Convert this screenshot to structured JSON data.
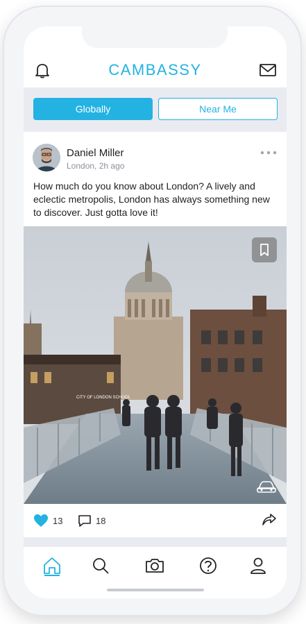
{
  "app": {
    "brand": "CAMBASSY"
  },
  "tabs": [
    {
      "label": "Globally",
      "active": true
    },
    {
      "label": "Near Me",
      "active": false
    }
  ],
  "post": {
    "author": "Daniel Miller",
    "meta": "London, 2h ago",
    "text": "How much do you know about London? A lively and eclectic metropolis, London has always something new to discover. Just gotta love it!",
    "likes": "13",
    "comments": "18",
    "image_text": "CITY OF LONDON SCHOOL"
  },
  "nav": [
    "home-icon",
    "search-icon",
    "camera-icon",
    "help-icon",
    "profile-icon"
  ],
  "colors": {
    "accent": "#23b2e2",
    "tab_bg": "#e9ebf1"
  }
}
